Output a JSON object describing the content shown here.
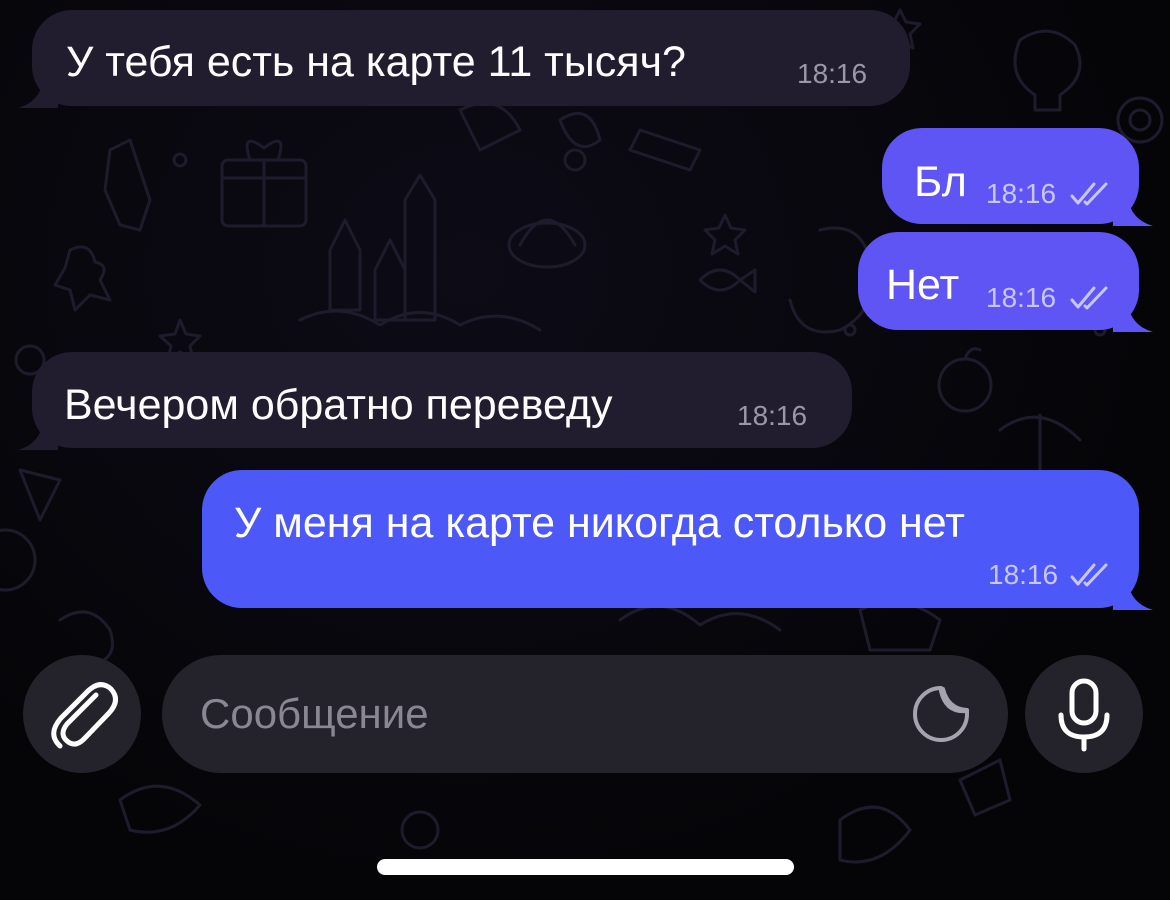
{
  "chat": {
    "messages": [
      {
        "direction": "incoming",
        "text": "У тебя есть на карте 11 тысяч?",
        "time": "18:16"
      },
      {
        "direction": "outgoing",
        "text": "Бл",
        "time": "18:16",
        "status": "read"
      },
      {
        "direction": "outgoing",
        "text": "Нет",
        "time": "18:16",
        "status": "read"
      },
      {
        "direction": "incoming",
        "text": "Вечером обратно переведу",
        "time": "18:16"
      },
      {
        "direction": "outgoing",
        "text": "У меня на карте никогда столько нет",
        "time": "18:16",
        "status": "read"
      }
    ]
  },
  "composer": {
    "placeholder": "Сообщение",
    "value": "",
    "attach_icon": "paperclip-icon",
    "sticker_icon": "sticker-icon",
    "mic_icon": "microphone-icon"
  },
  "colors": {
    "background": "#050508",
    "incoming_bubble": "#221d2e",
    "outgoing_bubble": "#5f55f5",
    "outgoing_bubble_bottom": "#4d58f8",
    "control_bg": "#24222b"
  }
}
